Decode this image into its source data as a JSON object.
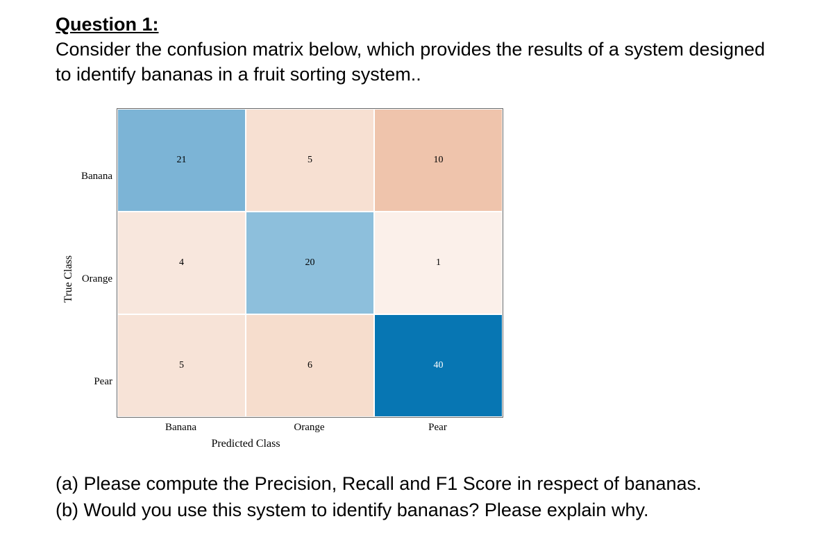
{
  "question": {
    "title": "Question 1:",
    "body": "Consider the confusion matrix below, which provides the results of a system designed to identify bananas in a fruit sorting system..",
    "part_a": "(a) Please compute the Precision, Recall and F1 Score in respect of bananas.",
    "part_b": "(b) Would you use this system to identify bananas? Please explain why."
  },
  "axes": {
    "y": "True Class",
    "x": "Predicted Class"
  },
  "row_labels": [
    "Banana",
    "Orange",
    "Pear"
  ],
  "col_labels": [
    "Banana",
    "Orange",
    "Pear"
  ],
  "chart_data": {
    "type": "heatmap",
    "title": "",
    "xlabel": "Predicted Class",
    "ylabel": "True Class",
    "categories_x": [
      "Banana",
      "Orange",
      "Pear"
    ],
    "categories_y": [
      "Banana",
      "Orange",
      "Pear"
    ],
    "values": [
      [
        21,
        5,
        10
      ],
      [
        4,
        20,
        1
      ],
      [
        5,
        6,
        40
      ]
    ],
    "cell_colors": [
      [
        "#7cb4d6",
        "#f7e0d2",
        "#efc4ac"
      ],
      [
        "#f8e7dd",
        "#8dbfdc",
        "#fbf0ea"
      ],
      [
        "#f7e3d7",
        "#f6ddcd",
        "#0776b3"
      ]
    ]
  }
}
